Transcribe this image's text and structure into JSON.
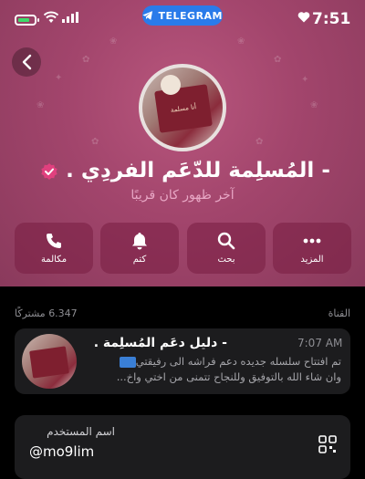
{
  "status_bar": {
    "time": "7:51",
    "pill_label": "TELEGRAM"
  },
  "profile": {
    "name": "- المُسلِمة للدّعَم الفردِي .",
    "last_seen": "آخر ظهور كان قريبًا",
    "avatar_caption": "أنا مسلمة"
  },
  "actions": [
    {
      "label": "مكالمة",
      "icon": "phone-icon"
    },
    {
      "label": "كتم",
      "icon": "bell-icon"
    },
    {
      "label": "بحث",
      "icon": "search-icon"
    },
    {
      "label": "المزيد",
      "icon": "more-icon"
    }
  ],
  "channel": {
    "section_label": "القناة",
    "subscribers": "6.347 مشتركًا",
    "title": "- دليل دعَم المُسلِمة .",
    "time": "7:07 AM",
    "preview_line1": "تم افتتاح سلسله جديده دعم فراشه الى رفيقتي",
    "preview_line2": "وان شاء الله بالتوفيق وللنجاح تتمنى من اختي واخ..."
  },
  "username": {
    "label": "اسم المستخدم",
    "value": "@mo9lim"
  },
  "colors": {
    "hero": "#a2456c",
    "accent_pill": "#2a7bea",
    "verified": "#e0407e",
    "last_seen": "#e8a7c5"
  }
}
